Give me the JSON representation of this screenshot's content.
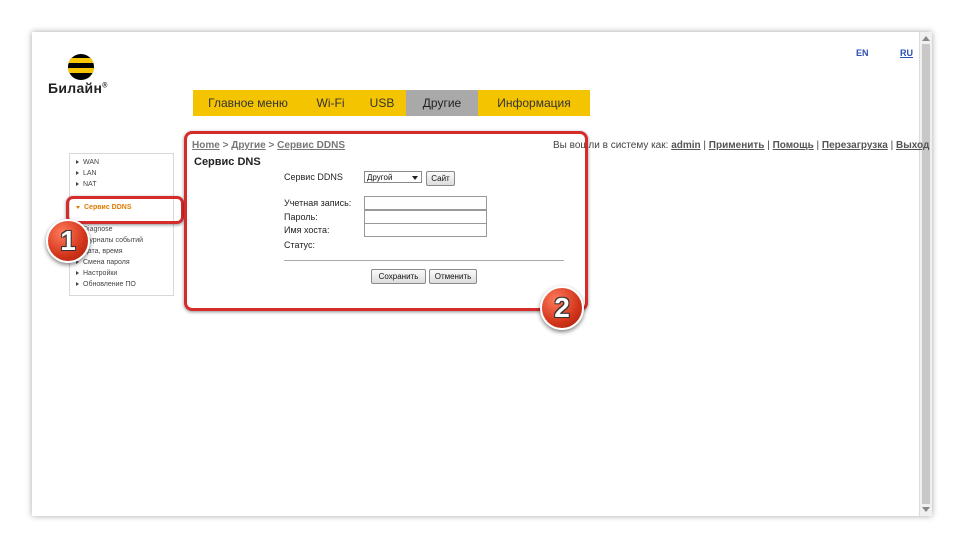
{
  "languages": {
    "en": "EN",
    "ru": "RU"
  },
  "brand": {
    "name": "Билайн",
    "mark": "®"
  },
  "nav": {
    "items": [
      {
        "label": "Главное меню"
      },
      {
        "label": "Wi-Fi"
      },
      {
        "label": "USB"
      },
      {
        "label": "Другие",
        "active": true
      },
      {
        "label": "Информация"
      }
    ]
  },
  "breadcrumb": {
    "home": "Home",
    "sep": " > ",
    "other": "Другие",
    "current": "Сервис DDNS"
  },
  "user_bar": {
    "prefix": "Вы вошли в систему как:",
    "user": "admin",
    "apply": "Применить",
    "help": "Помощь",
    "reboot": "Перезагрузка",
    "logout": "Выход",
    "sep": " | "
  },
  "sidebar": {
    "items": [
      {
        "label": "WAN"
      },
      {
        "label": "LAN"
      },
      {
        "label": "NAT"
      },
      {
        "label": "Сервис DDNS",
        "active": true
      },
      {
        "label": "Diagnose"
      },
      {
        "label": "Журналы событий"
      },
      {
        "label": "Дата, время"
      },
      {
        "label": "Смена пароля"
      },
      {
        "label": "Настройки"
      },
      {
        "label": "Обновление ПО"
      }
    ]
  },
  "form": {
    "title": "Сервис DNS",
    "ddns_label": "Сервис DDNS",
    "ddns_value": "Другой",
    "site_button": "Сайт",
    "account_label": "Учетная запись:",
    "account_value": "",
    "password_label": "Пароль:",
    "password_value": "",
    "host_label": "Имя хоста:",
    "host_value": "",
    "status_label": "Статус:",
    "save_button": "Сохранить",
    "cancel_button": "Отменить"
  },
  "callouts": {
    "first": "1",
    "second": "2",
    "color": "#d42b2b"
  },
  "colors": {
    "nav_bg": "#f5c400",
    "nav_active": "#a9a9a9",
    "sidebar_active": "#e07b00",
    "link_lang": "#2c4fb5"
  }
}
